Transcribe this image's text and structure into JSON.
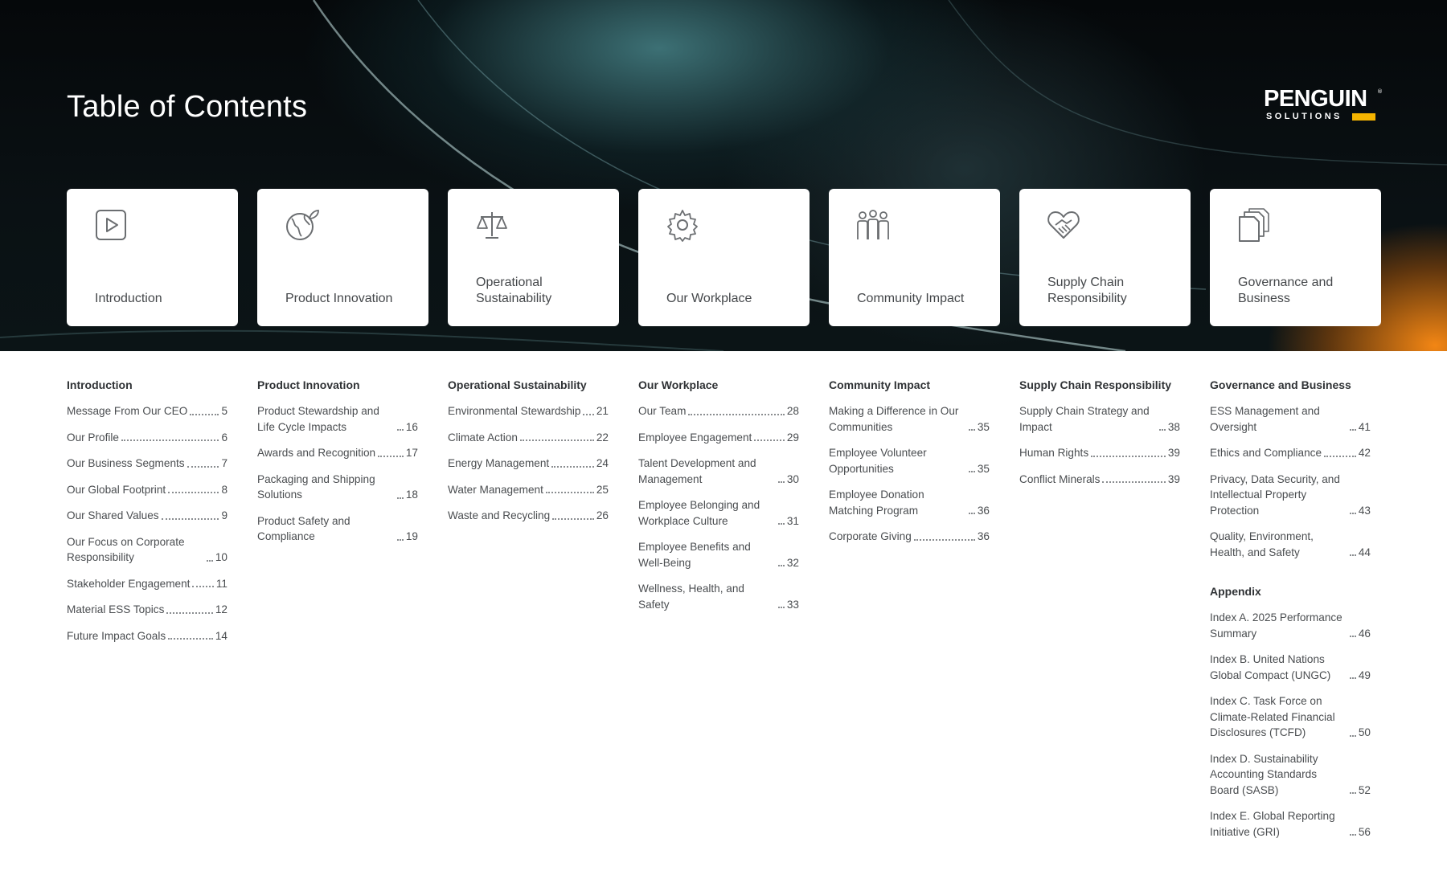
{
  "title": "Table of Contents",
  "logo": {
    "word": "PENGUIN",
    "sub": "SOLUTIONS",
    "reg": "®"
  },
  "colors": {
    "accent": "#f5b400",
    "orange_glow": "#ff8a14",
    "teal": "#4a8a8e",
    "dark": "#05080a"
  },
  "cards": [
    {
      "label": "Introduction",
      "icon": "play-icon"
    },
    {
      "label": "Product Innovation",
      "icon": "globe-leaf-icon"
    },
    {
      "label": "Operational Sustainability",
      "icon": "scale-icon"
    },
    {
      "label": "Our Workplace",
      "icon": "gear-icon"
    },
    {
      "label": "Community Impact",
      "icon": "people-icon"
    },
    {
      "label": "Supply Chain Responsibility",
      "icon": "heart-handshake-icon"
    },
    {
      "label": "Governance and Business",
      "icon": "documents-icon"
    }
  ],
  "sections": [
    {
      "heading": "Introduction",
      "entries": [
        {
          "title": "Message From Our CEO",
          "page": "5"
        },
        {
          "title": "Our Profile",
          "page": "6"
        },
        {
          "title": "Our Business Segments",
          "page": "7"
        },
        {
          "title": "Our Global Footprint",
          "page": "8"
        },
        {
          "title": "Our Shared Values",
          "page": "9"
        },
        {
          "title": "Our Focus on Corporate Responsibility",
          "page": "10"
        },
        {
          "title": "Stakeholder Engagement",
          "page": "11"
        },
        {
          "title": "Material ESS Topics",
          "page": "12"
        },
        {
          "title": "Future Impact Goals",
          "page": "14"
        }
      ]
    },
    {
      "heading": "Product Innovation",
      "entries": [
        {
          "title": "Product Stewardship and Life Cycle Impacts",
          "page": "16"
        },
        {
          "title": "Awards and Recognition",
          "page": "17"
        },
        {
          "title": "Packaging and Shipping Solutions",
          "page": "18"
        },
        {
          "title": "Product Safety and Compliance",
          "page": "19"
        }
      ]
    },
    {
      "heading": "Operational Sustainability",
      "entries": [
        {
          "title": "Environmental Stewardship",
          "page": "21"
        },
        {
          "title": "Climate Action",
          "page": "22"
        },
        {
          "title": "Energy Management",
          "page": "24"
        },
        {
          "title": "Water Management",
          "page": "25"
        },
        {
          "title": "Waste and Recycling",
          "page": "26"
        }
      ]
    },
    {
      "heading": "Our Workplace",
      "entries": [
        {
          "title": "Our Team",
          "page": "28"
        },
        {
          "title": "Employee Engagement",
          "page": "29"
        },
        {
          "title": "Talent Development and Management",
          "page": "30"
        },
        {
          "title": "Employee Belonging and Workplace Culture",
          "page": "31"
        },
        {
          "title": "Employee Benefits and Well-Being",
          "page": "32"
        },
        {
          "title": "Wellness, Health, and Safety",
          "page": "33"
        }
      ]
    },
    {
      "heading": "Community Impact",
      "entries": [
        {
          "title": "Making a Difference in Our Communities",
          "page": "35"
        },
        {
          "title": "Employee Volunteer Opportunities",
          "page": "35"
        },
        {
          "title": "Employee Donation Matching Program",
          "page": "36"
        },
        {
          "title": "Corporate Giving",
          "page": "36"
        }
      ]
    },
    {
      "heading": "Supply Chain Responsibility",
      "entries": [
        {
          "title": "Supply Chain Strategy and Impact",
          "page": "38"
        },
        {
          "title": "Human Rights",
          "page": "39"
        },
        {
          "title": "Conflict Minerals",
          "page": "39"
        }
      ]
    },
    {
      "heading": "Governance and Business",
      "entries": [
        {
          "title": "ESS Management and Oversight",
          "page": "41"
        },
        {
          "title": "Ethics and Compliance",
          "page": "42"
        },
        {
          "title": "Privacy, Data Security, and Intellectual Property Protection",
          "page": "43"
        },
        {
          "title": "Quality, Environment, Health, and Safety",
          "page": "44"
        }
      ]
    }
  ],
  "appendix": {
    "heading": "Appendix",
    "entries": [
      {
        "title": "Index A. 2025 Performance Summary",
        "page": "46"
      },
      {
        "title": "Index B. United Nations Global Compact (UNGC)",
        "page": "49"
      },
      {
        "title": "Index C. Task Force on Climate-Related Financial Disclosures (TCFD)",
        "page": "50"
      },
      {
        "title": "Index D. Sustainability Accounting Standards Board (SASB)",
        "page": "52"
      },
      {
        "title": "Index E. Global Reporting Initiative (GRI)",
        "page": "56"
      }
    ]
  }
}
